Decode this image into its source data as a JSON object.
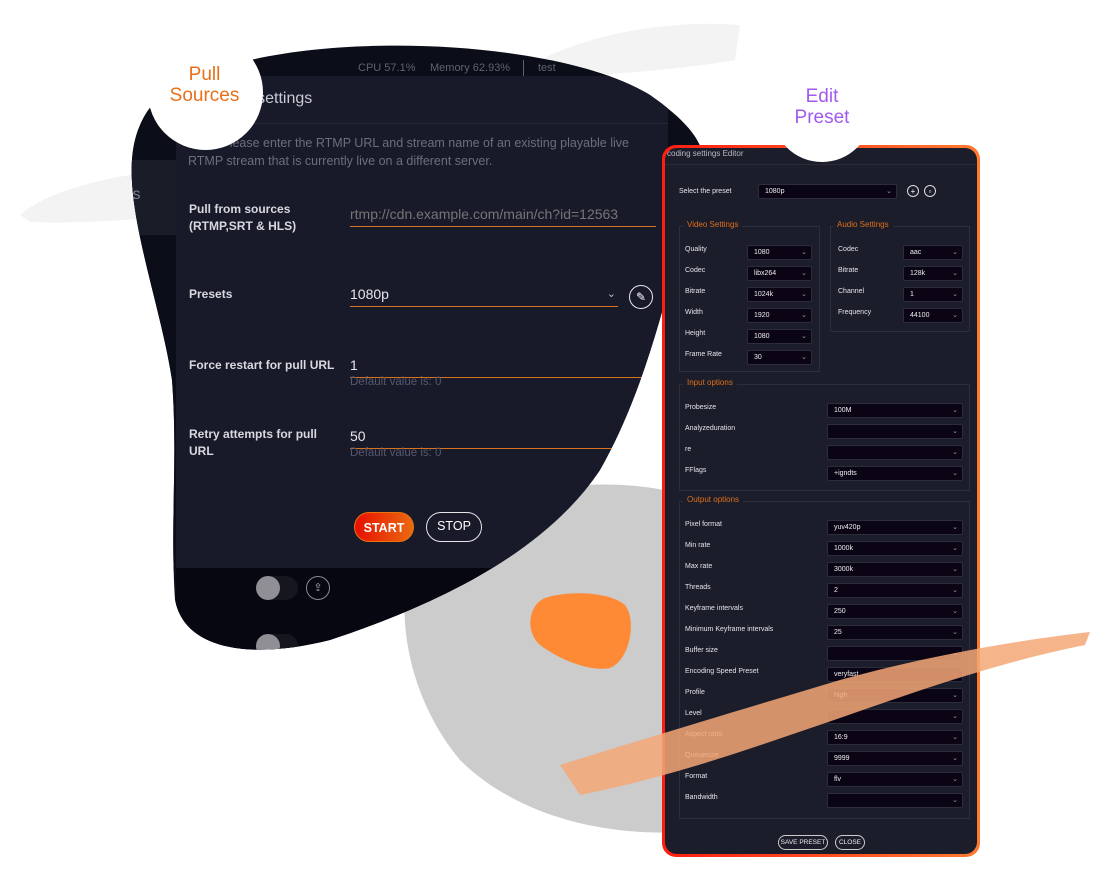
{
  "callouts": {
    "pull_sources": [
      "Pull",
      "Sources"
    ],
    "edit_preset": [
      "Edit",
      "Preset"
    ]
  },
  "colors": {
    "accent_orange": "#e8701a",
    "callout_purple": "#a259f0",
    "panel_dark": "#181a2a",
    "start_gradient": [
      "#e80f00",
      "#ea6a10"
    ]
  },
  "topbar": {
    "cpu": "CPU 57.1%",
    "memory": "Memory 62.93%",
    "user": "test"
  },
  "sidebar": {
    "partial_label": "els"
  },
  "streaming_modal": {
    "title": "Streaming settings",
    "title_visible": "ming settings",
    "note": "Note! Please enter the RTMP URL and stream name of an existing playable live RTMP stream that is currently live on a different server.",
    "fields": {
      "pull_sources": {
        "label": "Pull from sources (RTMP,SRT & HLS)",
        "placeholder": "rtmp://cdn.example.com/main/ch?id=12563",
        "value": ""
      },
      "presets": {
        "label": "Presets",
        "value": "1080p"
      },
      "force_restart": {
        "label": "Force restart for pull URL",
        "value": "1",
        "hint": "Default value is: 0"
      },
      "retry_attempts": {
        "label": "Retry attempts for pull URL",
        "value": "50",
        "hint": "Default value is: 0"
      }
    },
    "buttons": {
      "start": "START",
      "stop": "STOP"
    }
  },
  "preset_editor": {
    "title": "Encoding settings Editor",
    "title_visible": "coding settings Editor",
    "select_preset": {
      "label": "Select the preset",
      "value": "1080p"
    },
    "video_settings": {
      "legend": "Video Settings",
      "rows": [
        {
          "label": "Quality",
          "value": "1080"
        },
        {
          "label": "Codec",
          "value": "libx264"
        },
        {
          "label": "Bitrate",
          "value": "1024k"
        },
        {
          "label": "Width",
          "value": "1920"
        },
        {
          "label": "Height",
          "value": "1080"
        },
        {
          "label": "Frame Rate",
          "value": "30"
        }
      ]
    },
    "audio_settings": {
      "legend": "Audio Settings",
      "rows": [
        {
          "label": "Codec",
          "value": "aac"
        },
        {
          "label": "Bitrate",
          "value": "128k"
        },
        {
          "label": "Channel",
          "value": "1"
        },
        {
          "label": "Frequency",
          "value": "44100"
        }
      ]
    },
    "input_options": {
      "legend": "Input options",
      "rows": [
        {
          "label": "Probesize",
          "value": "100M"
        },
        {
          "label": "Analyzeduration",
          "value": ""
        },
        {
          "label": "re",
          "value": ""
        },
        {
          "label": "FFlags",
          "value": "+igndts"
        }
      ]
    },
    "output_options": {
      "legend": "Output options",
      "rows": [
        {
          "label": "Pixel format",
          "value": "yuv420p"
        },
        {
          "label": "Min rate",
          "value": "1000k"
        },
        {
          "label": "Max rate",
          "value": "3000k"
        },
        {
          "label": "Threads",
          "value": "2"
        },
        {
          "label": "Keyframe intervals",
          "value": "250"
        },
        {
          "label": "Minimum Keyframe intervals",
          "value": "25"
        },
        {
          "label": "Buffer size",
          "value": ""
        },
        {
          "label": "Encoding Speed Preset",
          "value": "veryfast"
        },
        {
          "label": "Profile",
          "value": "high"
        },
        {
          "label": "Level",
          "value": ""
        },
        {
          "label": "Aspect ratio",
          "value": "16:9"
        },
        {
          "label": "Queuesize",
          "value": "9999"
        },
        {
          "label": "Format",
          "value": "flv"
        },
        {
          "label": "Bandwidth",
          "value": ""
        }
      ]
    },
    "buttons": {
      "save": "SAVE PRESET",
      "close": "CLOSE"
    }
  }
}
